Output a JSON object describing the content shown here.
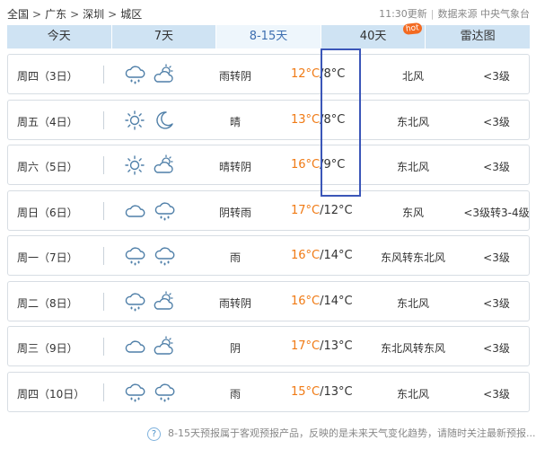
{
  "breadcrumb": {
    "items": [
      "全国",
      "广东",
      "深圳",
      "城区"
    ],
    "separator": ">"
  },
  "update": {
    "time": "11:30更新",
    "source": "数据来源 中央气象台"
  },
  "tabs": [
    {
      "label": "今天"
    },
    {
      "label": "7天"
    },
    {
      "label": "8-15天",
      "active": true
    },
    {
      "label": "40天",
      "badge": "hot"
    },
    {
      "label": "雷达图"
    }
  ],
  "forecast": [
    {
      "day": "周四（3日）",
      "icons": [
        "cloud-rain-icon",
        "partly-cloudy-icon"
      ],
      "weather": "雨转阴",
      "high": "12°C",
      "low": "/8°C",
      "wind": "北风",
      "level": "<3级"
    },
    {
      "day": "周五（4日）",
      "icons": [
        "sun-icon",
        "moon-icon"
      ],
      "weather": "晴",
      "high": "13°C",
      "low": "/8°C",
      "wind": "东北风",
      "level": "<3级"
    },
    {
      "day": "周六（5日）",
      "icons": [
        "sun-icon",
        "partly-cloudy-icon"
      ],
      "weather": "晴转阴",
      "high": "16°C",
      "low": "/9°C",
      "wind": "东北风",
      "level": "<3级"
    },
    {
      "day": "周日（6日）",
      "icons": [
        "cloud-icon",
        "cloud-rain-icon"
      ],
      "weather": "阴转雨",
      "high": "17°C",
      "low": "/12°C",
      "wind": "东风",
      "level": "<3级转3-4级"
    },
    {
      "day": "周一（7日）",
      "icons": [
        "cloud-rain-icon",
        "cloud-rain-icon"
      ],
      "weather": "雨",
      "high": "16°C",
      "low": "/14°C",
      "wind": "东风转东北风",
      "level": "<3级"
    },
    {
      "day": "周二（8日）",
      "icons": [
        "cloud-rain-icon",
        "partly-cloudy-icon"
      ],
      "weather": "雨转阴",
      "high": "16°C",
      "low": "/14°C",
      "wind": "东北风",
      "level": "<3级"
    },
    {
      "day": "周三（9日）",
      "icons": [
        "cloud-icon",
        "partly-cloudy-icon"
      ],
      "weather": "阴",
      "high": "17°C",
      "low": "/13°C",
      "wind": "东北风转东风",
      "level": "<3级"
    },
    {
      "day": "周四（10日）",
      "icons": [
        "cloud-rain-icon",
        "cloud-rain-icon"
      ],
      "weather": "雨",
      "high": "15°C",
      "low": "/13°C",
      "wind": "东北风",
      "level": "<3级"
    }
  ],
  "footer": {
    "text": "8-15天预报属于客观预报产品，反映的是未来天气变化趋势，请随时关注最新预报..."
  },
  "colors": {
    "accent": "#3e6fb0",
    "high_temp": "#f07a14",
    "highlight_box": "#3b56b8",
    "tab_bg": "#cfe3f3"
  }
}
